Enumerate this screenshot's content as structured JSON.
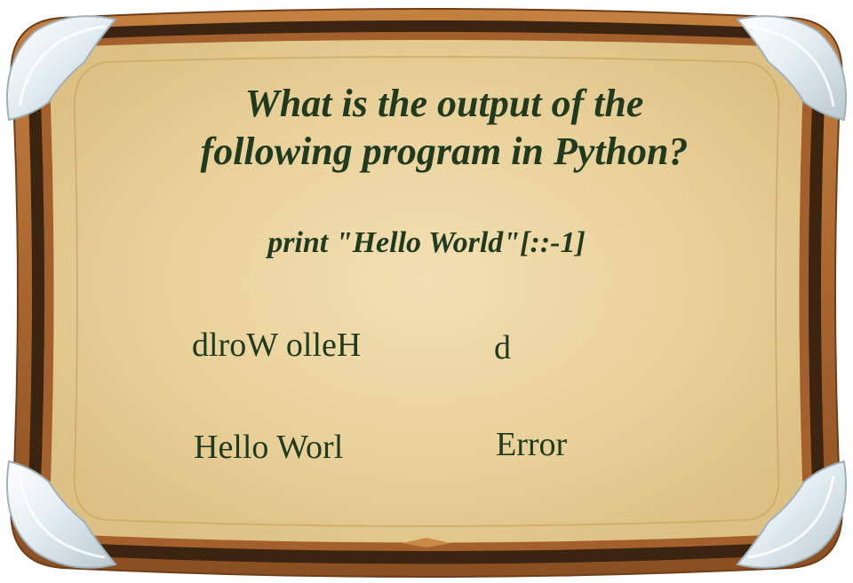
{
  "question": {
    "line1": "What is the output of the",
    "line2": "following program in Python?"
  },
  "code": "print \"Hello World\"[::-1]",
  "options": [
    {
      "text": "dlroW olleH"
    },
    {
      "text": "d"
    },
    {
      "text": "Hello Worl"
    },
    {
      "text": "Error"
    }
  ],
  "colors": {
    "text": "#1f3a1f",
    "board_fill": "#e6cd94",
    "board_center": "#f0dcae",
    "frame_dark": "#3b2511",
    "frame_wood": "#9a5a2a",
    "frame_outer": "#b8743c",
    "corner_silver": "#e6eff3"
  },
  "icons": [
    "corner-ornament-icon"
  ]
}
